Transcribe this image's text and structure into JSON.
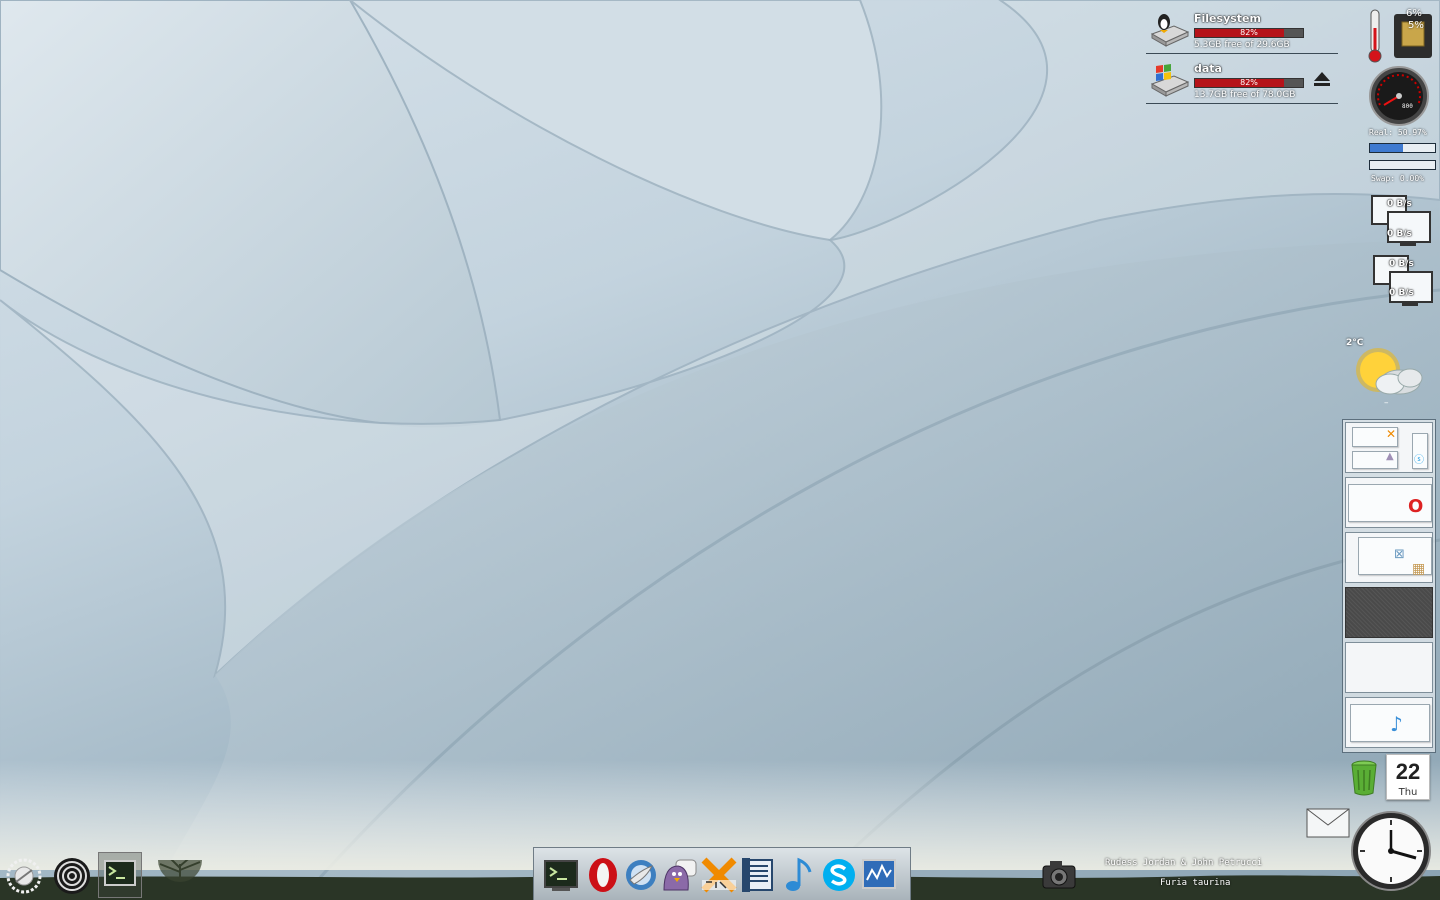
{
  "disks": [
    {
      "name": "Filesystem",
      "percent": 82,
      "percent_label": "82%",
      "free_label": "5.3GB free of 29.6GB",
      "icon": "linux-drive-icon"
    },
    {
      "name": "data",
      "percent": 82,
      "percent_label": "82%",
      "free_label": "13.7GB free of 78.0GB",
      "icon": "windows-drive-icon"
    }
  ],
  "cpu": {
    "core1": "6%",
    "core2": "5%"
  },
  "memory": {
    "gauge_label": "800",
    "real_label": "Real: 50.97%",
    "real_value": 50.97,
    "swap_label": "Swap: 0.00%",
    "swap_value": 0.0
  },
  "network": [
    {
      "down": "0 B/s",
      "up": "0 B/s"
    },
    {
      "down": "0 B/s",
      "up": "0 B/s"
    }
  ],
  "weather": {
    "temperature": "2°C",
    "sub": "–",
    "icon": "partly-cloudy-icon"
  },
  "calendar": {
    "day": "22",
    "weekday": "Thu"
  },
  "now_playing": {
    "artist": "Rudess Jordan & John Petrucci",
    "title": "Furia taurina"
  },
  "dock": [
    "terminal",
    "opera",
    "thunderbird",
    "pidgin",
    "xchat",
    "document-viewer",
    "music-player",
    "skype",
    "system-monitor"
  ],
  "colors": {
    "disk_fill": "#b5131a",
    "mem_fill": "#3f7ad0",
    "opera": "#cc0f16",
    "skype": "#00aff0"
  }
}
